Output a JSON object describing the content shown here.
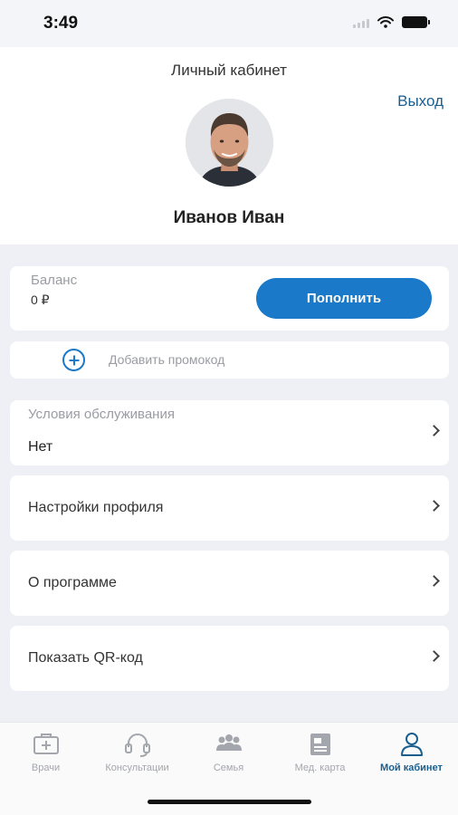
{
  "status_bar": {
    "time": "3:49"
  },
  "header": {
    "title": "Личный кабинет",
    "logout_label": "Выход",
    "user_name": "Иванов Иван"
  },
  "balance": {
    "label": "Баланс",
    "value": "0 ₽",
    "topup_label": "Пополнить"
  },
  "promo": {
    "label": "Добавить промокод"
  },
  "terms": {
    "label": "Условия обслуживания",
    "value": "Нет"
  },
  "menu": [
    {
      "label": "Настройки профиля"
    },
    {
      "label": "О программе"
    },
    {
      "label": "Показать QR-код"
    }
  ],
  "tabs": [
    {
      "label": "Врачи",
      "icon": "medical-case-icon"
    },
    {
      "label": "Консультации",
      "icon": "headset-icon"
    },
    {
      "label": "Семья",
      "icon": "family-icon"
    },
    {
      "label": "Мед. карта",
      "icon": "medical-card-icon"
    },
    {
      "label": "Мой кабинет",
      "icon": "user-icon",
      "active": true
    }
  ],
  "colors": {
    "accent": "#1a79c9",
    "link": "#1a5f8f",
    "background": "#eef0f5",
    "inactive_tab": "#a3a6ad"
  }
}
